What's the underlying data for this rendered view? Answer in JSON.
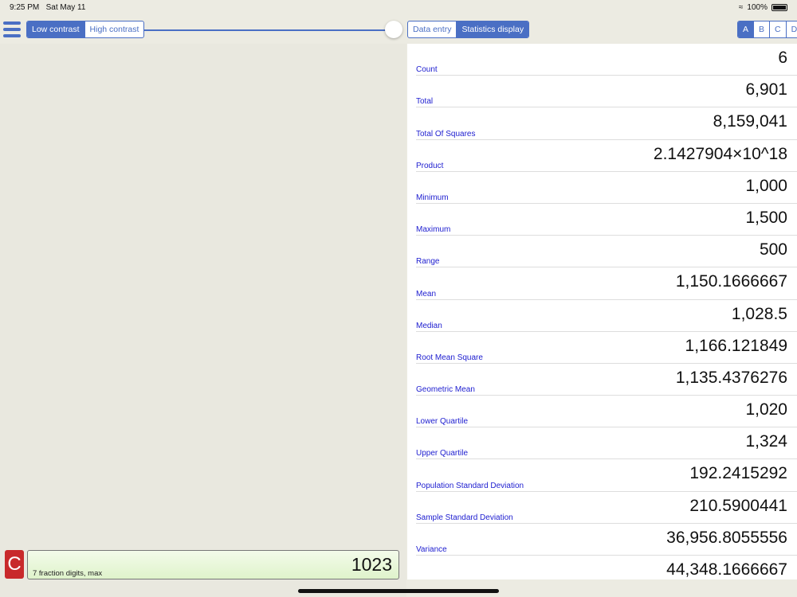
{
  "status": {
    "time": "9:25 PM",
    "date": "Sat May 11",
    "battery": "100%"
  },
  "toolbar": {
    "contrast": [
      "Low contrast",
      "High contrast"
    ],
    "contrast_selected": 0,
    "slider_value": 1.0,
    "view": [
      "Data entry",
      "Statistics display"
    ],
    "view_selected": 1,
    "sets": [
      "A",
      "B",
      "C",
      "D"
    ],
    "set_selected": 0
  },
  "stats": [
    {
      "label": "Count",
      "value": "6"
    },
    {
      "label": "Total",
      "value": "6,901"
    },
    {
      "label": "Total Of Squares",
      "value": "8,159,041"
    },
    {
      "label": "Product",
      "value": "2.1427904×10^18"
    },
    {
      "label": "Minimum",
      "value": "1,000"
    },
    {
      "label": "Maximum",
      "value": "1,500"
    },
    {
      "label": "Range",
      "value": "500"
    },
    {
      "label": "Mean",
      "value": "1,150.1666667"
    },
    {
      "label": "Median",
      "value": "1,028.5"
    },
    {
      "label": "Root Mean Square",
      "value": "1,166.121849"
    },
    {
      "label": "Geometric Mean",
      "value": "1,135.4376276"
    },
    {
      "label": "Lower Quartile",
      "value": "1,020"
    },
    {
      "label": "Upper Quartile",
      "value": "1,324"
    },
    {
      "label": "Population Standard Deviation",
      "value": "192.2415292"
    },
    {
      "label": "Sample Standard Deviation",
      "value": "210.5900441"
    },
    {
      "label": "Variance",
      "value": "36,956.8055556"
    },
    {
      "label": "",
      "value": "44,348.1666667"
    }
  ],
  "entry": {
    "clear": "C",
    "value": "1023",
    "hint": "7 fraction digits, max"
  }
}
